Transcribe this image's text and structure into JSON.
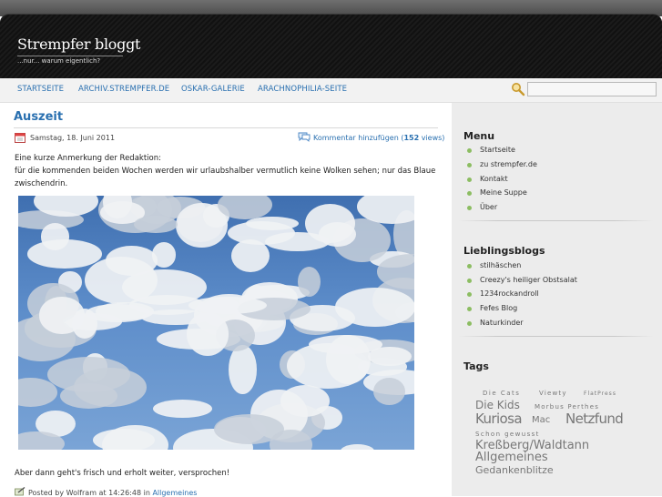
{
  "header": {
    "title": "Strempfer bloggt",
    "subtitle": "...nur... warum eigentlich?"
  },
  "nav": {
    "items": [
      "STARTSEITE",
      "ARCHIV.STREMPFER.DE",
      "OSKAR-GALERIE",
      "ARACHNOPHILIA-SEITE"
    ],
    "search_placeholder": ""
  },
  "post": {
    "title": "Auszeit",
    "date": "Samstag, 18. Juni 2011",
    "comment_link": "Kommentar hinzufügen",
    "views_open": " (",
    "views_count": "152",
    "views_close": " views)",
    "line1": "Eine kurze Anmerkung der Redaktion:",
    "line2": "für die kommenden beiden Wochen werden wir urlaubshalber vermutlich keine Wolken sehen; nur das Blaue",
    "line3": "zwischendrin.",
    "line4": "Aber dann geht's frisch und erholt weiter, versprochen!",
    "posted_prefix": "Posted by Wolfram at 14:26:48 in ",
    "category": "Allgemeines"
  },
  "sidebar": {
    "menu_title": "Menu",
    "menu_items": [
      "Startseite",
      "zu strempfer.de",
      "Kontakt",
      "Meine Suppe",
      "Über"
    ],
    "blogs_title": "Lieblingsblogs",
    "blog_items": [
      "stilhäschen",
      "Creezy's heiliger Obstsalat",
      "1234rockandroll",
      "Fefes Blog",
      "Naturkinder"
    ],
    "tags_title": "Tags",
    "tags": [
      "Die Cats",
      "Viewty",
      "FlatPress",
      "Die Kids",
      "Morbus Perthes",
      "Kuriosa",
      "Mac",
      "Netzfund",
      "Schon gewusst",
      "Kreßberg/Waldtann",
      "Allgemeines",
      "Gedankenblitze"
    ]
  },
  "colors": {
    "accent": "#2a70b0",
    "bullet": "#8cbd62",
    "header_bg": "#141414",
    "sidebar_bg": "#ececec"
  }
}
